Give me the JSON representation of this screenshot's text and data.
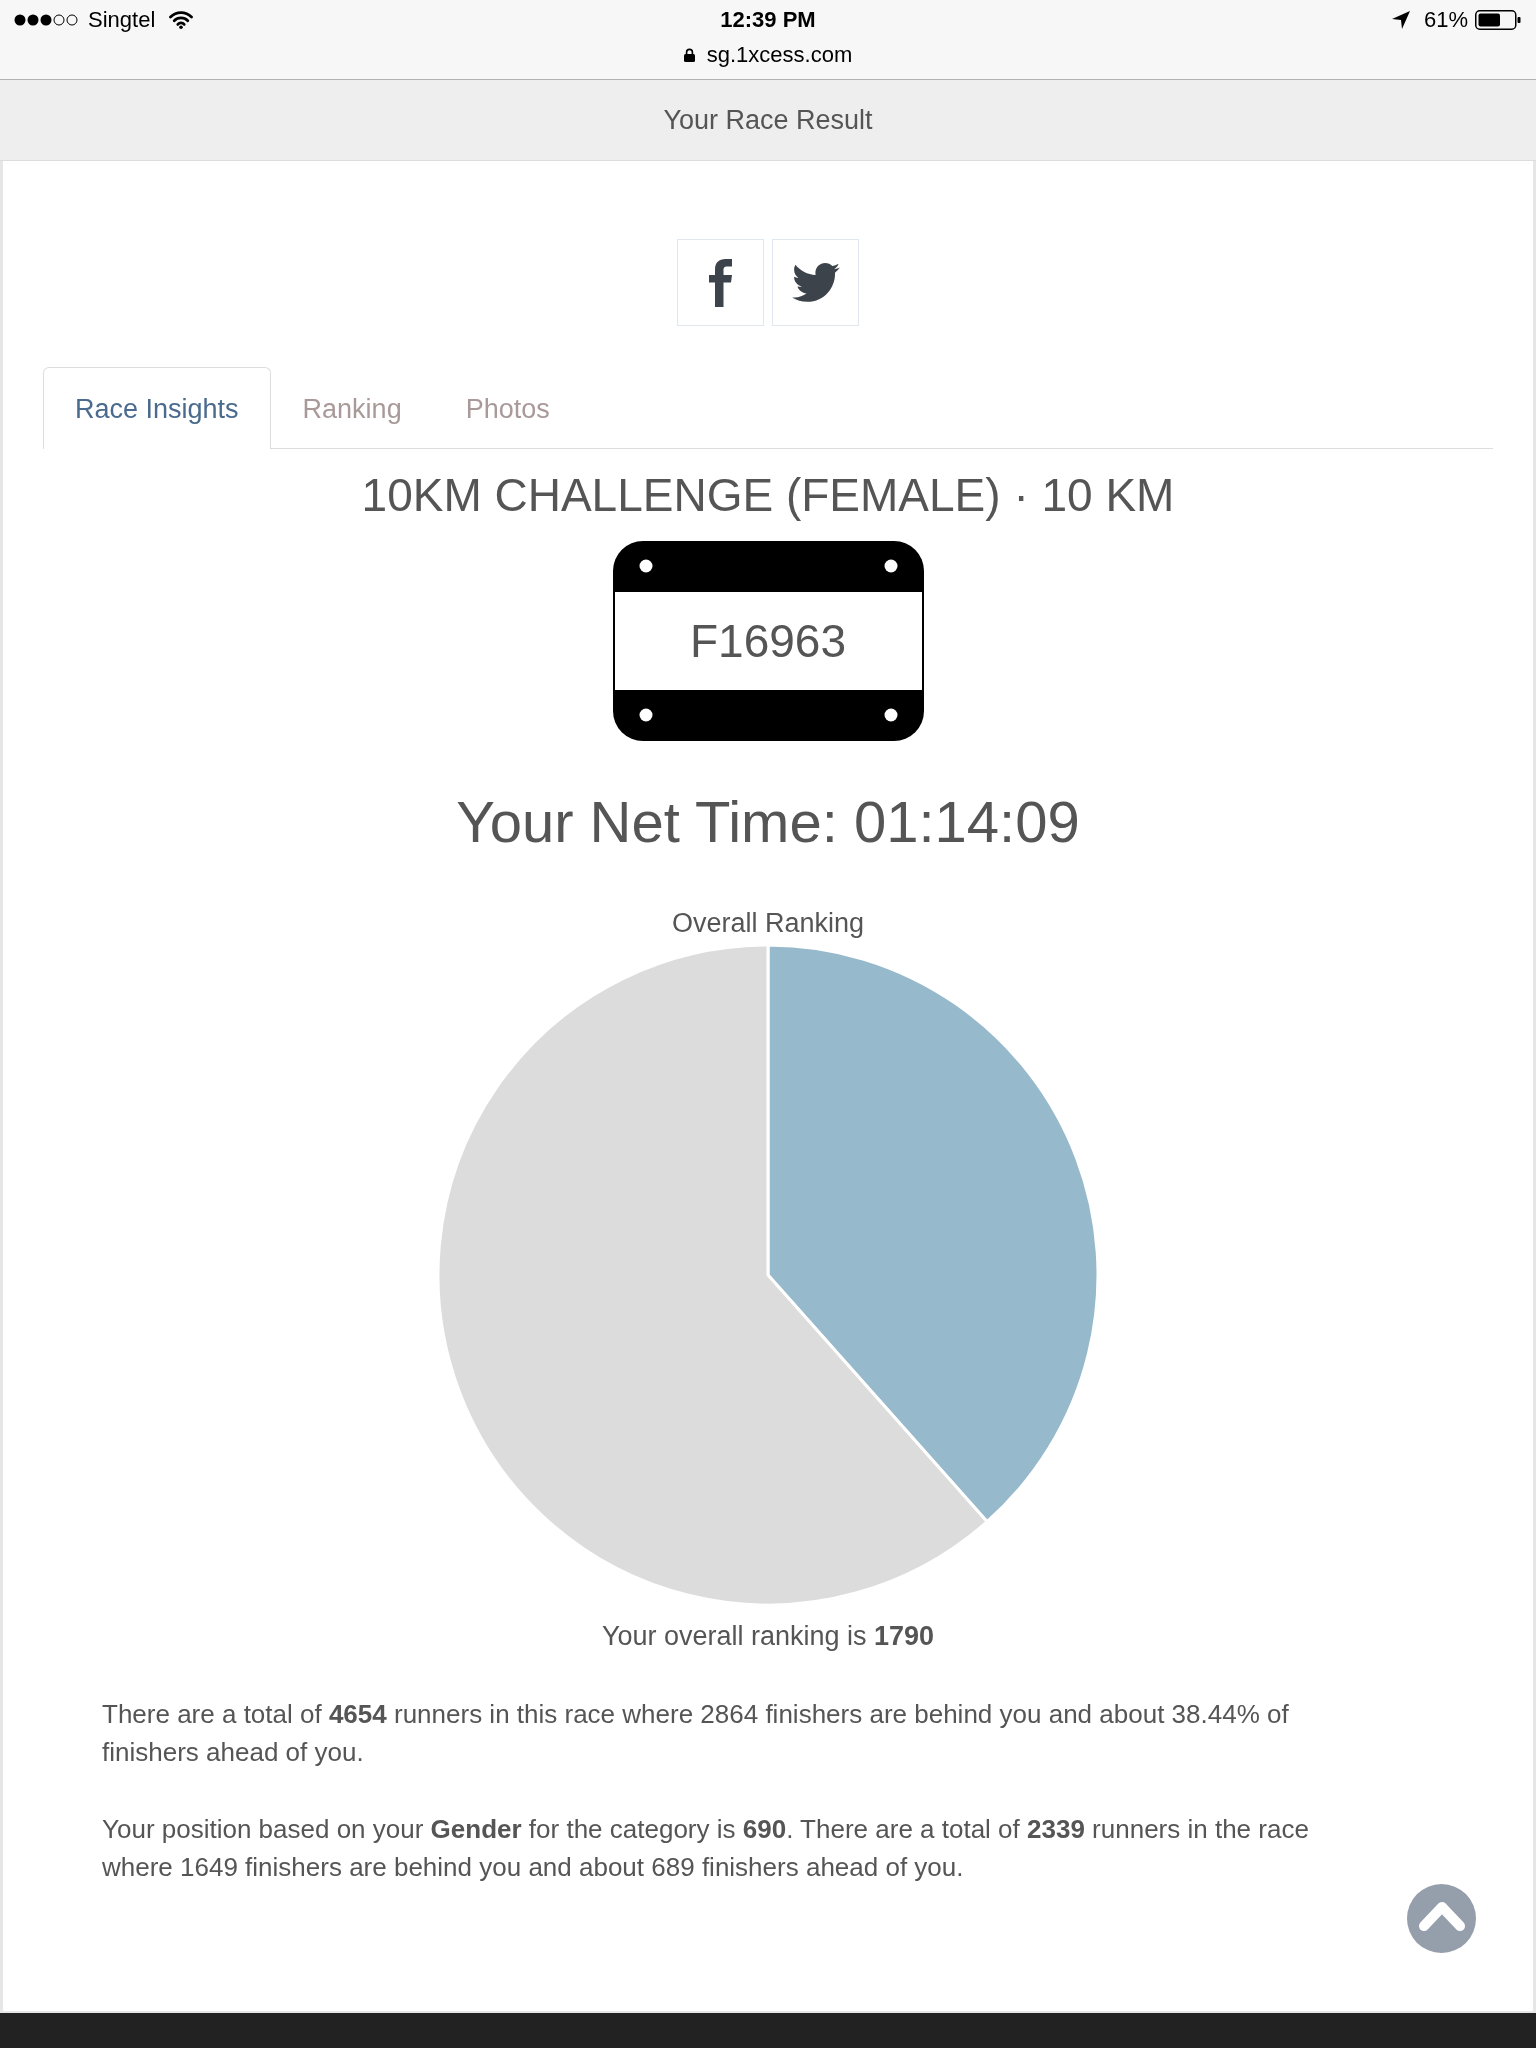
{
  "status_bar": {
    "carrier": "Singtel",
    "time": "12:39 PM",
    "url": "sg.1xcess.com",
    "battery": "61%"
  },
  "header": {
    "title": "Your Race Result"
  },
  "tabs": [
    {
      "label": "Race Insights",
      "selected": true
    },
    {
      "label": "Ranking",
      "selected": false
    },
    {
      "label": "Photos",
      "selected": false
    }
  ],
  "race": {
    "title": "10KM CHALLENGE (FEMALE) · 10 KM",
    "bib_number": "F16963",
    "net_time": "Your Net Time: 01:14:09"
  },
  "overall_ranking": {
    "chart_data": {
      "type": "pie",
      "title": "Overall Ranking",
      "values": [
        38.44,
        61.56
      ]
    },
    "caption": "Your overall ranking is **1790**"
  },
  "paragraphs": [
    "There are a total of **4654** runners in this race where 2864 finishers are behind you and about 38.44% of finishers ahead of you.",
    "Your position based on your **Gender** for the category is **690**. There are a total of **2339** runners in the race where 1649 finishers are behind you and about 689 finishers ahead of you."
  ]
}
